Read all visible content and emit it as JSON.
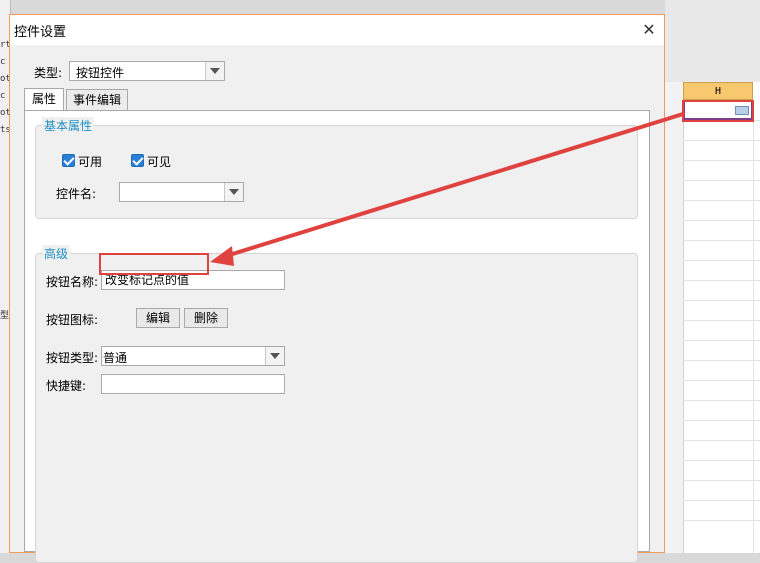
{
  "background": {
    "left_fragments": [
      "rt",
      "c",
      "ot",
      "c",
      "ot",
      "ts",
      "型"
    ],
    "column_header": "H"
  },
  "dialog": {
    "title": "控件设置",
    "close_glyph": "✕",
    "type_label": "类型:",
    "type_value": "按钮控件",
    "tabs": [
      {
        "label": "属性",
        "active": true
      },
      {
        "label": "事件编辑",
        "active": false
      }
    ],
    "basic": {
      "legend": "基本属性",
      "enabled_label": "可用",
      "visible_label": "可见",
      "name_label": "控件名:",
      "name_value": ""
    },
    "advanced": {
      "legend": "高级",
      "button_name_label": "按钮名称:",
      "button_name_value": "改变标记点的值",
      "button_icon_label": "按钮图标:",
      "edit_label": "编辑",
      "delete_label": "删除",
      "button_type_label": "按钮类型:",
      "button_type_value": "普通",
      "shortcut_label": "快捷键:",
      "shortcut_value": ""
    }
  },
  "colors": {
    "accent_blue": "#1f8ec6",
    "highlight_red": "#e0423f",
    "dialog_border": "#f29a5e",
    "column_header": "#f7c86e"
  }
}
